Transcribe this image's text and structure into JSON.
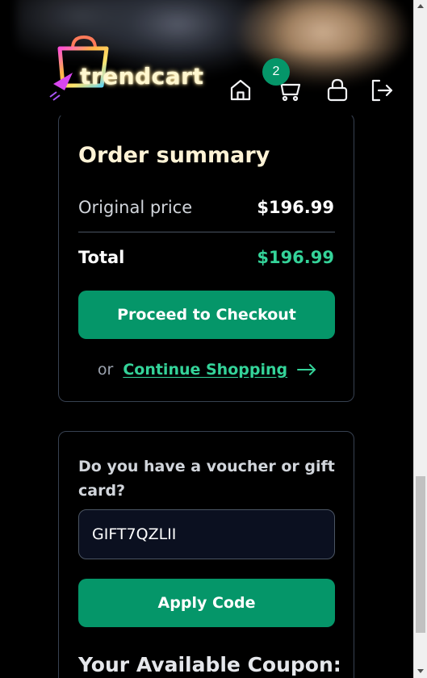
{
  "header": {
    "brand": "trendcart",
    "cart_count": "2",
    "icons": [
      "home-icon",
      "cart-icon",
      "lock-icon",
      "logout-icon"
    ],
    "accent_color": "#059669"
  },
  "order_summary": {
    "title": "Order summary",
    "original_price_label": "Original price",
    "original_price_value": "$196.99",
    "total_label": "Total",
    "total_value": "$196.99",
    "checkout_label": "Proceed to Checkout",
    "or_text": "or",
    "continue_label": "Continue Shopping",
    "total_color": "#34d399"
  },
  "voucher": {
    "question": "Do you have a voucher or gift card?",
    "input_value": "GIFT7QZLII",
    "apply_label": "Apply Code",
    "coupons_title": "Your Available Coupon:"
  }
}
